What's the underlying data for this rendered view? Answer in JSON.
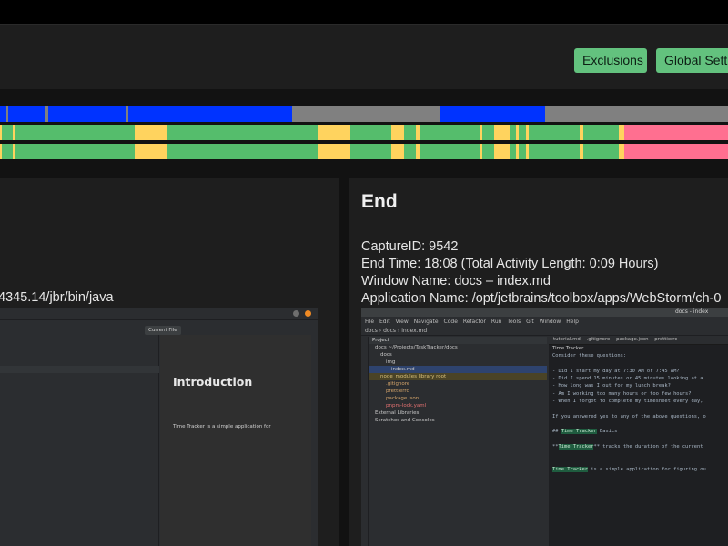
{
  "toolbar": {
    "exclusions_label": "Exclusions",
    "global_settings_label": "Global Setti"
  },
  "timeline": {
    "colors": {
      "blue": "#0033ff",
      "gray": "#808080",
      "green": "#55bd6c",
      "yellow": "#ffd35e",
      "pink": "#ff6f90"
    }
  },
  "start_panel": {
    "java_path_fragment": "4345.14/jbr/bin/java",
    "screenshot": {
      "file_tab": "Current File",
      "heading": "Introduction",
      "paragraph": "Time Tracker is a simple application for"
    }
  },
  "end_panel": {
    "title": "End",
    "capture_id": "CaptureID: 9542",
    "end_time": "End Time: 18:08 (Total Activity Length: 0:09 Hours)",
    "window_name": "Window Name: docs – index.md",
    "application_name": "Application Name: /opt/jetbrains/toolbox/apps/WebStorm/ch-0",
    "screenshot": {
      "window_title": "docs - index",
      "menu": [
        "File",
        "Edit",
        "View",
        "Navigate",
        "Code",
        "Refactor",
        "Run",
        "Tools",
        "Git",
        "Window",
        "Help"
      ],
      "breadcrumb": "docs  ›  docs  ›  index.md",
      "project_label": "Project",
      "tree": [
        "docs  ~/Projects/TaskTracker/docs",
        "docs",
        "img",
        "index.md",
        "node_modules  library root",
        ".gitignore",
        "prettierrc",
        "package.json",
        "pnpm-lock.yaml",
        "External Libraries",
        "Scratches and Consoles"
      ],
      "tabs": [
        "tutorial.md",
        ".gitignore",
        "package.json",
        "prettierrc"
      ],
      "editor_title": "Time Tracker",
      "editor_lines": [
        "Consider these questions:",
        "",
        "- Did I start my day at 7:30 AM or 7:45 AM?",
        "- Did I spend 15 minutes or 45 minutes looking at a",
        "- How long was I out for my lunch break?",
        "- Am I working too many hours or too few hours?",
        "- When I forgot to complete my timesheet every day,",
        "",
        "If you answered yes to any of the above questions, o",
        "",
        "## Time Tracker Basics",
        "",
        "**Time Tracker** tracks the duration of the current",
        "",
        "",
        "Time Tracker is a simple application for figuring ou"
      ]
    }
  }
}
